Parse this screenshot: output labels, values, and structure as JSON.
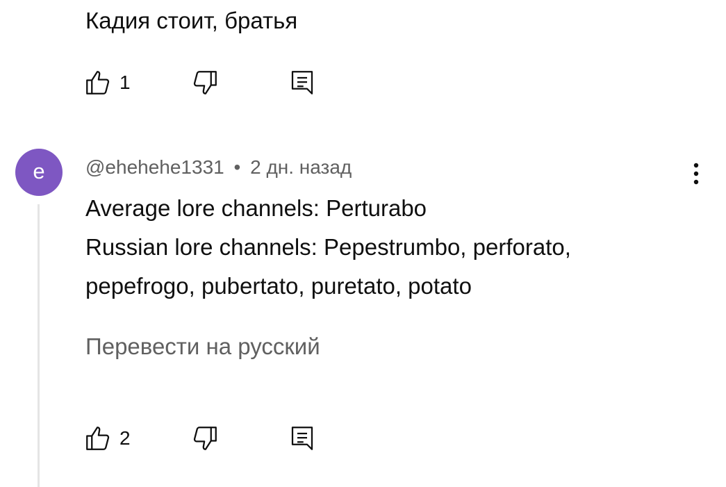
{
  "previous_comment": {
    "text": "Кадия стоит, братья",
    "like_count": "1",
    "icons": {
      "like": "thumbs-up-icon",
      "dislike": "thumbs-down-icon",
      "reply": "reply-icon"
    }
  },
  "comment": {
    "avatar_letter": "e",
    "avatar_color": "#7e57c2",
    "author": "@ehehehe1331",
    "separator": "•",
    "time": "2 дн. назад",
    "lines": [
      "Average lore channels: Perturabo",
      "Russian lore channels: Pepestrumbo, perforato,",
      "pepefrogo, pubertato, puretato, potato"
    ],
    "translate_label": "Перевести на русский",
    "like_count": "2",
    "icons": {
      "like": "thumbs-up-icon",
      "dislike": "thumbs-down-icon",
      "reply": "reply-icon",
      "menu": "more-vertical-icon"
    }
  },
  "colors": {
    "text_primary": "#0f0f0f",
    "text_secondary": "#606060",
    "thread_line": "#e5e5e5"
  }
}
